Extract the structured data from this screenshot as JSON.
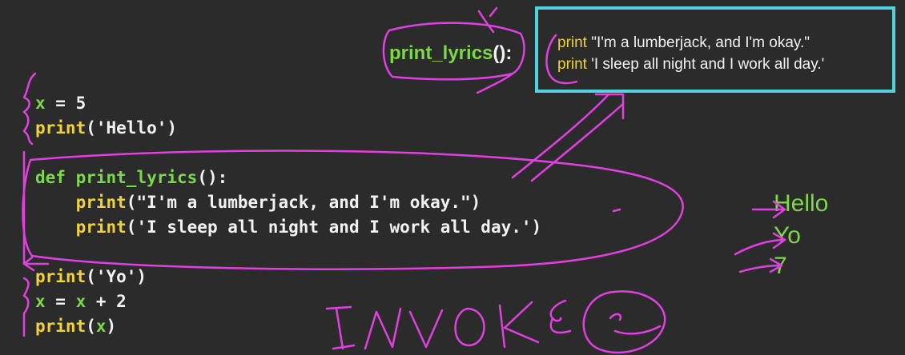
{
  "code_lines": [
    {
      "parts": [
        {
          "t": "x",
          "c": "var"
        },
        {
          "t": " = 5",
          "c": "num"
        }
      ]
    },
    {
      "parts": [
        {
          "t": "print",
          "c": "fn"
        },
        {
          "t": "('Hello')",
          "c": "str"
        }
      ]
    },
    {
      "parts": []
    },
    {
      "parts": [
        {
          "t": "def",
          "c": "kw"
        },
        {
          "t": " ",
          "c": "str"
        },
        {
          "t": "print_lyrics",
          "c": "kw"
        },
        {
          "t": "():",
          "c": "str"
        }
      ]
    },
    {
      "parts": [
        {
          "t": "    print",
          "c": "fn"
        },
        {
          "t": "(\"I'm a lumberjack, and I'm okay.\")",
          "c": "str"
        }
      ]
    },
    {
      "parts": [
        {
          "t": "    print",
          "c": "fn"
        },
        {
          "t": "('I sleep all night and I work all day.')",
          "c": "str"
        }
      ]
    },
    {
      "parts": []
    },
    {
      "parts": [
        {
          "t": "print",
          "c": "fn"
        },
        {
          "t": "('Yo')",
          "c": "str"
        }
      ]
    },
    {
      "parts": [
        {
          "t": "x",
          "c": "var"
        },
        {
          "t": " = ",
          "c": "str"
        },
        {
          "t": "x",
          "c": "var"
        },
        {
          "t": " + 2",
          "c": "num"
        }
      ]
    },
    {
      "parts": [
        {
          "t": "print",
          "c": "fn"
        },
        {
          "t": "(",
          "c": "str"
        },
        {
          "t": "x",
          "c": "var"
        },
        {
          "t": ")",
          "c": "str"
        }
      ]
    }
  ],
  "def_label": {
    "name": "print_lyrics",
    "parens": "():"
  },
  "function_body": {
    "line1_kw": "print",
    "line1_text": " \"I'm a lumberjack, and I'm okay.\"",
    "line2_kw": "print",
    "line2_text": " 'I sleep all night and I work all day.'"
  },
  "output": [
    "Hello",
    "Yo",
    "7"
  ],
  "annotation": "INVOKE",
  "colors": {
    "background": "#2b2b2b",
    "keyword_green": "#7cd74a",
    "print_yellow": "#f0d23a",
    "box_cyan": "#53d3dd",
    "ink_magenta": "#e040e0"
  }
}
